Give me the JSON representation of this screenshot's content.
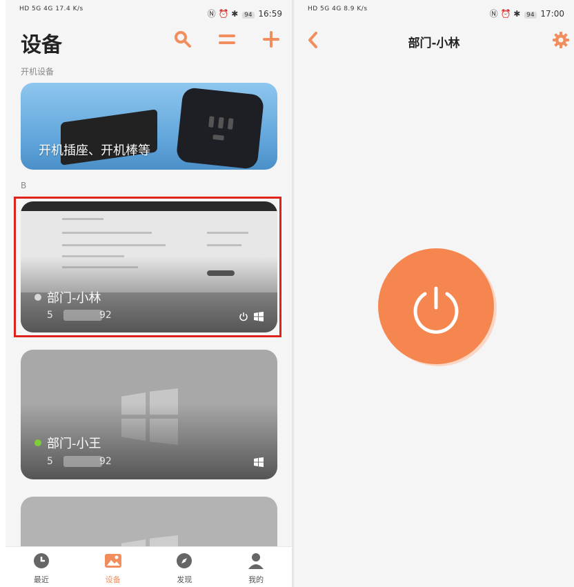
{
  "left": {
    "status": {
      "signal": "HD 5G 4G",
      "speed": "17.4",
      "speed_unit": "K/s",
      "battery": "94",
      "time": "16:59"
    },
    "title": "设备",
    "section_on": "开机设备",
    "promo_text": "开机插座、开机棒等",
    "section_b": "B",
    "devices": [
      {
        "name": "部门-小林",
        "ip_start": "5",
        "ip_end": "92",
        "status_color": "#d8d8d8"
      },
      {
        "name": "部门-小王",
        "ip_start": "5",
        "ip_end": "92",
        "status_color": "#7ccf3a"
      }
    ],
    "tabs": [
      {
        "label": "最近",
        "icon": "clock-icon"
      },
      {
        "label": "设备",
        "icon": "gallery-icon"
      },
      {
        "label": "发现",
        "icon": "compass-icon"
      },
      {
        "label": "我的",
        "icon": "user-icon"
      }
    ]
  },
  "right": {
    "status": {
      "signal": "HD 5G 4G",
      "speed": "8.9",
      "speed_unit": "K/s",
      "battery": "94",
      "time": "17:00"
    },
    "title": "部门-小林"
  },
  "colors": {
    "accent": "#f28d5d",
    "power": "#f6864f",
    "highlight": "#e0221d",
    "online": "#7ccf3a"
  }
}
